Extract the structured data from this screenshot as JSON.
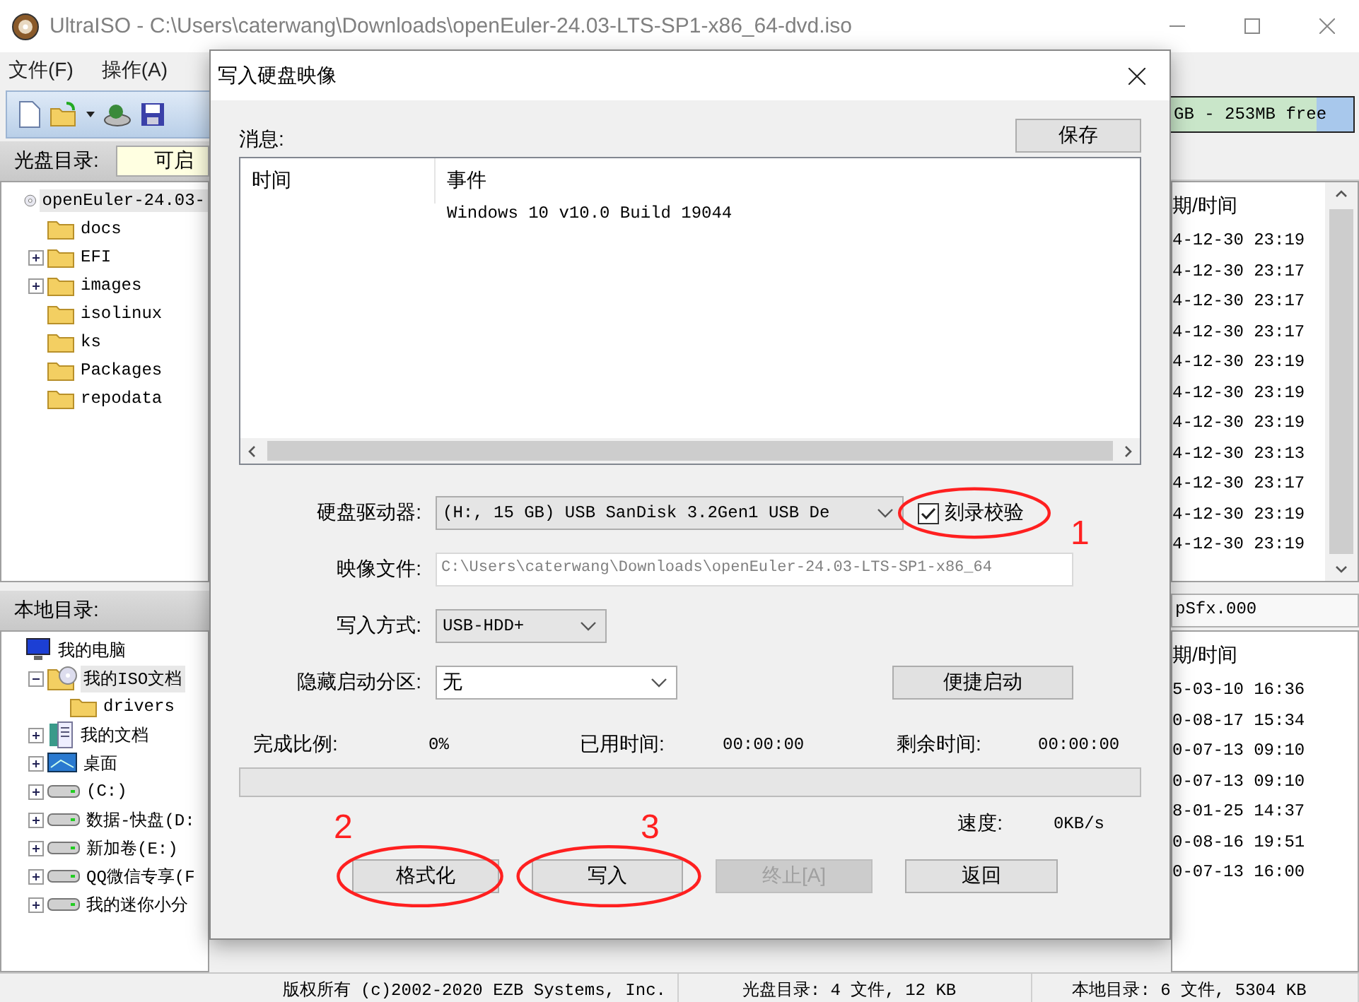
{
  "window": {
    "title": "UltraISO - C:\\Users\\caterwang\\Downloads\\openEuler-24.03-LTS-SP1-x86_64-dvd.iso"
  },
  "menu": [
    "文件(F)",
    "操作(A)"
  ],
  "free_space": {
    "text": "GB - 253MB free",
    "level": 0.8
  },
  "iso_pane": {
    "label": "光盘目录:",
    "boot_field": "可启",
    "tree": [
      {
        "name": "openEuler-24.03-",
        "kind": "disc",
        "expandable": false,
        "selected": true,
        "children": [
          {
            "name": "docs",
            "kind": "folder",
            "expandable": false,
            "selected": false
          },
          {
            "name": "EFI",
            "kind": "folder",
            "expandable": true,
            "expanded": false,
            "selected": false
          },
          {
            "name": "images",
            "kind": "folder",
            "expandable": true,
            "expanded": false,
            "selected": false
          },
          {
            "name": "isolinux",
            "kind": "folder",
            "expandable": false,
            "selected": false
          },
          {
            "name": "ks",
            "kind": "folder",
            "expandable": false,
            "selected": false
          },
          {
            "name": "Packages",
            "kind": "folder",
            "expandable": false,
            "selected": false
          },
          {
            "name": "repodata",
            "kind": "folder",
            "expandable": false,
            "selected": false
          }
        ]
      }
    ]
  },
  "local_pane": {
    "label": "本地目录:",
    "tree": [
      {
        "name": "我的电脑",
        "kind": "computer",
        "expandable": false,
        "selected": false,
        "children": [
          {
            "name": "我的ISO文档",
            "kind": "discfolder",
            "expandable": true,
            "expanded": true,
            "selected": true,
            "children": [
              {
                "name": "drivers",
                "kind": "folder",
                "expandable": false,
                "selected": false
              }
            ]
          },
          {
            "name": "我的文档",
            "kind": "documents",
            "expandable": true,
            "expanded": false,
            "selected": false
          },
          {
            "name": "桌面",
            "kind": "desktop",
            "expandable": true,
            "expanded": false,
            "selected": false
          },
          {
            "name": "(C:)",
            "kind": "drive",
            "expandable": true,
            "expanded": false,
            "selected": false
          },
          {
            "name": "数据-快盘(D:",
            "kind": "drive",
            "expandable": true,
            "expanded": false,
            "selected": false
          },
          {
            "name": "新加卷(E:)",
            "kind": "drive",
            "expandable": true,
            "expanded": false,
            "selected": false
          },
          {
            "name": "QQ微信专享(F",
            "kind": "drive",
            "expandable": true,
            "expanded": false,
            "selected": false
          },
          {
            "name": "我的迷你小分",
            "kind": "drive",
            "expandable": true,
            "expanded": false,
            "selected": false
          }
        ]
      }
    ]
  },
  "iso_files": {
    "column": "期/时间",
    "rows": [
      "4-12-30 23:19",
      "4-12-30 23:17",
      "4-12-30 23:17",
      "4-12-30 23:17",
      "4-12-30 23:19",
      "4-12-30 23:19",
      "4-12-30 23:19",
      "4-12-30 23:13",
      "4-12-30 23:17",
      "4-12-30 23:19",
      "4-12-30 23:19"
    ]
  },
  "local_files": {
    "path": "pSfx.000",
    "column": "期/时间",
    "rows": [
      "5-03-10 16:36",
      "0-08-17 15:34",
      "0-07-13 09:10",
      "0-07-13 09:10",
      "8-01-25 14:37",
      "0-08-16 19:51",
      "0-07-13 16:00"
    ]
  },
  "dialog": {
    "title": "写入硬盘映像",
    "message_label": "消息:",
    "save_button": "保存",
    "log": {
      "columns": [
        "时间",
        "事件"
      ],
      "rows": [
        {
          "event": "Windows 10 v10.0 Build 19044"
        }
      ]
    },
    "drive": {
      "label": "硬盘驱动器:",
      "value": "(H:, 15 GB) USB  SanDisk 3.2Gen1 USB De"
    },
    "verify": {
      "label": "刻录校验",
      "checked": true,
      "annotation": "1"
    },
    "image_file": {
      "label": "映像文件:",
      "value": "C:\\Users\\caterwang\\Downloads\\openEuler-24.03-LTS-SP1-x86_64",
      "disabled": true
    },
    "write_method": {
      "label": "写入方式:",
      "value": "USB-HDD+"
    },
    "hide_partition": {
      "label": "隐藏启动分区:",
      "value": "无"
    },
    "quick_boot_button": "便捷启动",
    "progress": {
      "items": [
        {
          "label": "完成比例:",
          "value": "0%"
        },
        {
          "label": "已用时间:",
          "value": "00:00:00"
        },
        {
          "label": "剩余时间:",
          "value": "00:00:00"
        }
      ],
      "level": 0,
      "speed_label": "速度:",
      "speed": "0KB/s"
    },
    "buttons": [
      {
        "label": "格式化",
        "disabled": false,
        "annotation": "2"
      },
      {
        "label": "写入",
        "disabled": false,
        "annotation": "3"
      },
      {
        "label": "终止[A]",
        "disabled": true
      },
      {
        "label": "返回",
        "disabled": false
      }
    ]
  },
  "status_bar": [
    "版权所有 (c)2002-2020 EZB Systems, Inc.",
    "光盘目录: 4 文件, 12 KB",
    "本地目录: 6 文件, 5304 KB"
  ]
}
